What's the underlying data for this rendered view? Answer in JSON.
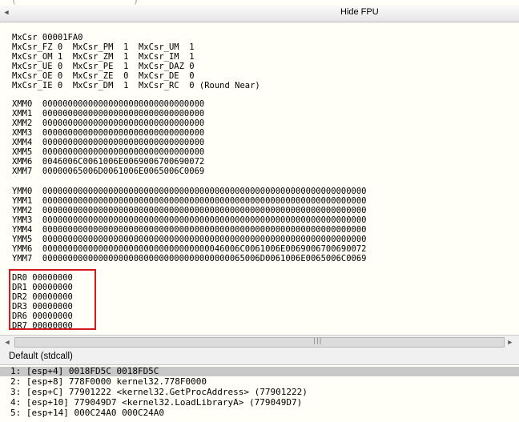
{
  "top_cutoff_text": "(                      )",
  "header": {
    "hide_fpu_label": "Hide FPU"
  },
  "mxcsr_lines": [
    "MxCsr 00001FA0",
    "MxCsr_FZ 0  MxCsr_PM  1  MxCsr_UM  1",
    "MxCsr_OM 1  MxCsr_ZM  1  MxCsr_IM  1",
    "MxCsr_UE 0  MxCsr_PE  1  MxCsr_DAZ 0",
    "MxCsr_OE 0  MxCsr_ZE  0  MxCsr_DE  0",
    "MxCsr_IE 0  MxCsr_DM  1  MxCsr_RC  0 (Round Near)"
  ],
  "xmm_lines": [
    "XMM0  00000000000000000000000000000000",
    "XMM1  00000000000000000000000000000000",
    "XMM2  00000000000000000000000000000000",
    "XMM3  00000000000000000000000000000000",
    "XMM4  00000000000000000000000000000000",
    "XMM5  00000000000000000000000000000000",
    "XMM6  0046006C0061006E0069006700690072",
    "XMM7  00000065006D0061006E0065006C0069"
  ],
  "ymm_lines": [
    "YMM0  0000000000000000000000000000000000000000000000000000000000000000",
    "YMM1  0000000000000000000000000000000000000000000000000000000000000000",
    "YMM2  0000000000000000000000000000000000000000000000000000000000000000",
    "YMM3  0000000000000000000000000000000000000000000000000000000000000000",
    "YMM4  0000000000000000000000000000000000000000000000000000000000000000",
    "YMM5  0000000000000000000000000000000000000000000000000000000000000000",
    "YMM6  000000000000000000000000000000000046006C0061006E0069006700690072",
    "YMM7  0000000000000000000000000000000000000065006D0061006E0065006C0069"
  ],
  "dr_lines": [
    "DR0 00000000",
    "DR1 00000000",
    "DR2 00000000",
    "DR3 00000000",
    "DR6 00000000",
    "DR7 00000000"
  ],
  "stack": {
    "calling_convention": "Default (stdcall)",
    "rows": [
      "1: [esp+4] 0018FD5C 0018FD5C",
      "2: [esp+8] 778F0000 kernel32.778F0000",
      "3: [esp+C] 77901222 <kernel32.GetProcAddress> (77901222)",
      "4: [esp+10] 779049D7 <kernel32.LoadLibraryA> (779049D7)",
      "5: [esp+14] 000C24A0 000C24A0"
    ]
  },
  "icons": {
    "scroll_left": "triangle-left",
    "scroll_right": "triangle-right",
    "thumb_grip": "grip"
  },
  "colors": {
    "panel_bg": "#fffff7",
    "highlight_border": "#d11a1a",
    "selected_row": "#c8c8c8"
  }
}
